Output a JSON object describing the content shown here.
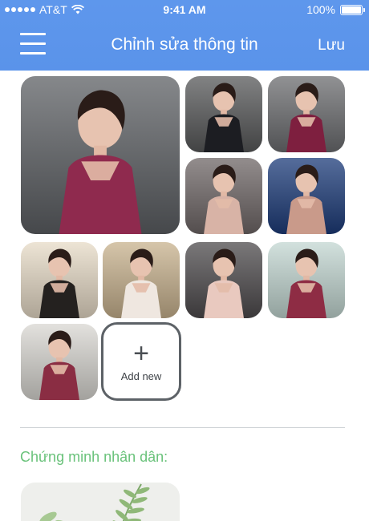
{
  "status_bar": {
    "carrier": "AT&T",
    "time": "9:41 AM",
    "battery": "100%"
  },
  "header": {
    "title": "Chỉnh sửa thông tin",
    "save_label": "Lưu"
  },
  "gallery": {
    "photos": [
      {
        "id": "main-photo",
        "bg": "#5d6064",
        "dress": "#8f2a4e"
      },
      {
        "id": "photo-2",
        "bg": "#58595a",
        "dress": "#1c1d22"
      },
      {
        "id": "photo-3",
        "bg": "#6c6d70",
        "dress": "#7e1f3f"
      },
      {
        "id": "photo-4",
        "bg": "#6f6767",
        "dress": "#d8b3a6"
      },
      {
        "id": "photo-5",
        "bg": "#1d3c7a",
        "dress": "#c99a8a"
      },
      {
        "id": "photo-6",
        "bg": "#e7dbc7",
        "dress": "#24211f"
      },
      {
        "id": "photo-7",
        "bg": "#c8b28e",
        "dress": "#efe7e0"
      },
      {
        "id": "photo-8",
        "bg": "#4e4b4d",
        "dress": "#e9c9bf"
      },
      {
        "id": "photo-9",
        "bg": "#c3d7d2",
        "dress": "#8e2c44"
      },
      {
        "id": "photo-10",
        "bg": "#d9d7d2",
        "dress": "#8a2d43"
      }
    ],
    "add_new_label": "Add new"
  },
  "id_section": {
    "title": "Chứng minh nhân dân:"
  },
  "colors": {
    "header": "#5a93ea",
    "accent_green": "#69c27a",
    "add_border": "#5d6267"
  }
}
